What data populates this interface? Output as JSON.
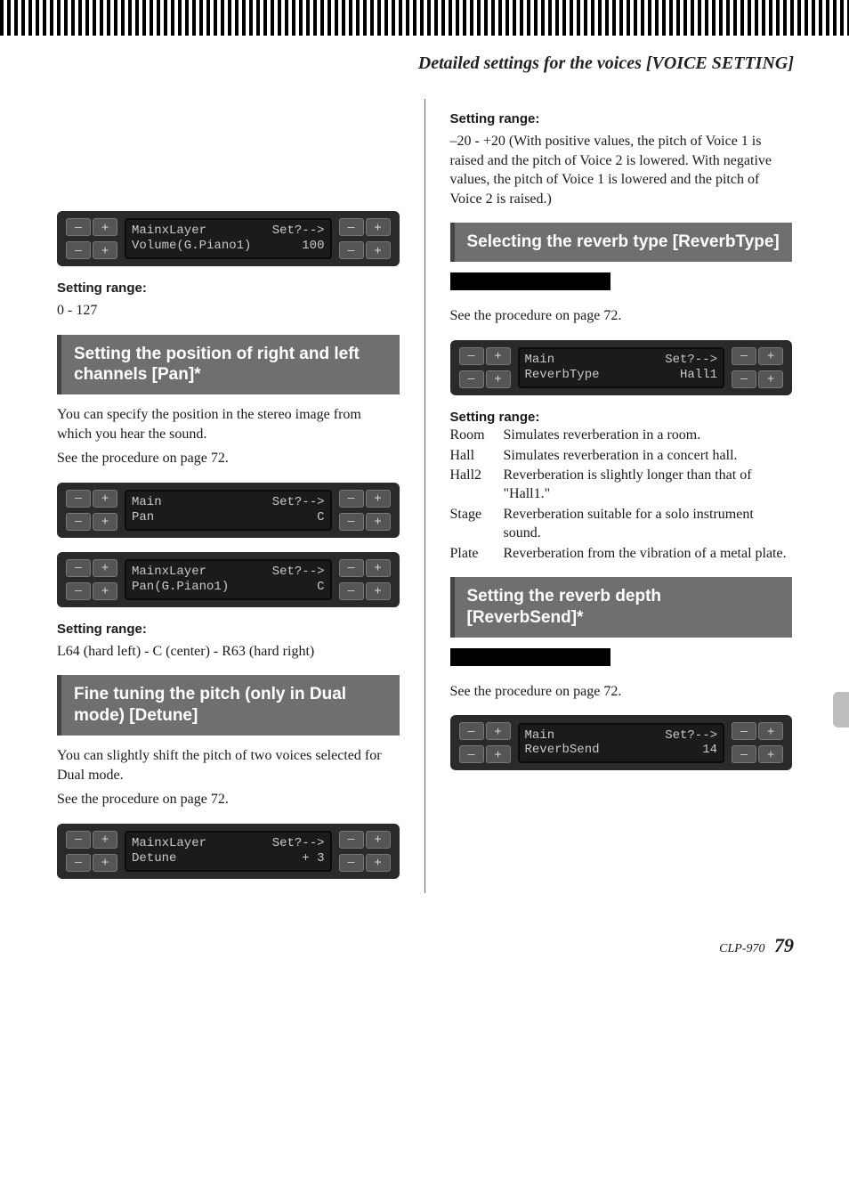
{
  "header": "Detailed settings for the voices [VOICE SETTING]",
  "lcd1": {
    "l1a": "MainxLayer",
    "l1b": "Set?-->",
    "l2a": "Volume(G.Piano1)",
    "l2b": "100"
  },
  "vol": {
    "label": "Setting range:",
    "range": "0 - 127"
  },
  "pan": {
    "title": "Setting the position of right and left channels [Pan]*",
    "desc": "You can specify the position in the stereo image from which you hear the sound.",
    "see": "See the procedure on page 72.",
    "lcdA": {
      "l1a": "Main",
      "l1b": "Set?-->",
      "l2a": "Pan",
      "l2b": "C"
    },
    "lcdB": {
      "l1a": "MainxLayer",
      "l1b": "Set?-->",
      "l2a": "Pan(G.Piano1)",
      "l2b": "C"
    },
    "range_label": "Setting range:",
    "range": "L64 (hard left) - C (center) - R63 (hard right)"
  },
  "detune": {
    "title": "Fine tuning the pitch (only in Dual mode) [Detune]",
    "desc": "You can slightly shift the pitch of two voices selected for Dual mode.",
    "see": "See the procedure on page 72.",
    "lcd": {
      "l1a": "MainxLayer",
      "l1b": "Set?-->",
      "l2a": "Detune",
      "l2b": "+ 3"
    },
    "range_label": "Setting range:",
    "range_text": "–20 - +20 (With positive values, the pitch of Voice 1 is raised and the pitch of Voice 2 is lowered. With negative values, the pitch of Voice 1 is lowered and the pitch of Voice 2 is raised.)"
  },
  "reverbType": {
    "title": "Selecting the reverb type [ReverbType]",
    "see": "See the procedure on page 72.",
    "lcd": {
      "l1a": "Main",
      "l1b": "Set?-->",
      "l2a": "ReverbType",
      "l2b": "Hall1"
    },
    "range_label": "Setting range:",
    "options": [
      {
        "key": "Room",
        "desc": "Simulates reverberation in a room."
      },
      {
        "key": "Hall",
        "desc": "Simulates reverberation in a concert hall."
      },
      {
        "key": "Hall2",
        "desc": "Reverberation is slightly longer than that of \"Hall1.\""
      },
      {
        "key": "Stage",
        "desc": "Reverberation suitable for a solo instrument sound."
      },
      {
        "key": "Plate",
        "desc": "Reverberation from the vibration of a metal plate."
      }
    ]
  },
  "reverbSend": {
    "title": "Setting the reverb depth [ReverbSend]*",
    "see": "See the procedure on page 72.",
    "lcd": {
      "l1a": "Main",
      "l1b": "Set?-->",
      "l2a": "ReverbSend",
      "l2b": "14"
    }
  },
  "footer": {
    "model": "CLP-970",
    "page": "79"
  },
  "glyph": {
    "minus": "–",
    "plus": "+"
  }
}
